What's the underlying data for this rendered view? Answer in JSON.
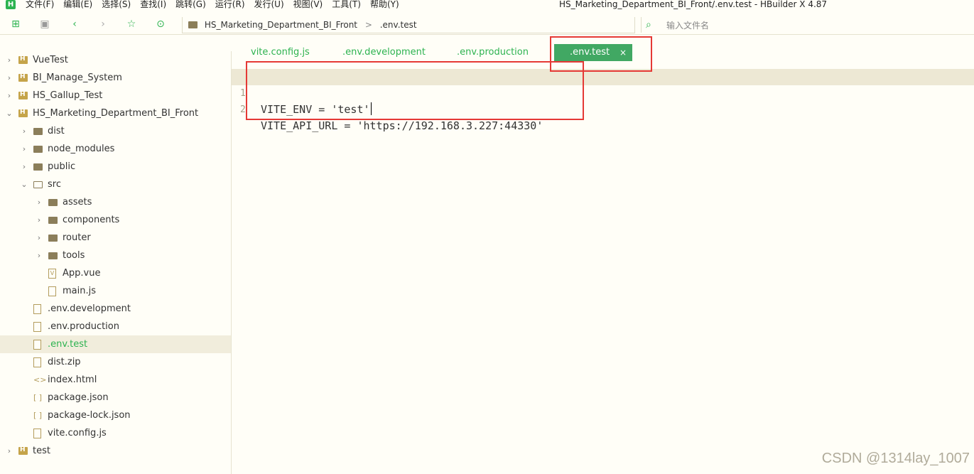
{
  "menubar": {
    "logo": "H",
    "items": [
      "文件(F)",
      "编辑(E)",
      "选择(S)",
      "查找(I)",
      "跳转(G)",
      "运行(R)",
      "发行(U)",
      "视图(V)",
      "工具(T)",
      "帮助(Y)"
    ],
    "window_title": "HS_Marketing_Department_BI_Front/.env.test - HBuilder X 4.87"
  },
  "toolbar": {
    "breadcrumb": [
      "HS_Marketing_Department_BI_Front",
      ".env.test"
    ],
    "breadcrumb_sep": ">",
    "search_placeholder": "输入文件名"
  },
  "sidebar": {
    "items": [
      {
        "label": "VueTest",
        "depth": 0,
        "icon": "project-icon",
        "expandable": true
      },
      {
        "label": "BI_Manage_System",
        "depth": 0,
        "icon": "project-icon",
        "expandable": true
      },
      {
        "label": "HS_Gallup_Test",
        "depth": 0,
        "icon": "project-icon",
        "expandable": true
      },
      {
        "label": "HS_Marketing_Department_BI_Front",
        "depth": 0,
        "icon": "project-icon",
        "expandable": true,
        "expanded": true
      },
      {
        "label": "dist",
        "depth": 1,
        "icon": "folder-icon",
        "expandable": true
      },
      {
        "label": "node_modules",
        "depth": 1,
        "icon": "folder-icon",
        "expandable": true
      },
      {
        "label": "public",
        "depth": 1,
        "icon": "folder-icon",
        "expandable": true
      },
      {
        "label": "src",
        "depth": 1,
        "icon": "folder-open-icon",
        "expandable": true,
        "expanded": true
      },
      {
        "label": "assets",
        "depth": 2,
        "icon": "folder-icon",
        "expandable": true
      },
      {
        "label": "components",
        "depth": 2,
        "icon": "folder-icon",
        "expandable": true
      },
      {
        "label": "router",
        "depth": 2,
        "icon": "folder-icon",
        "expandable": true
      },
      {
        "label": "tools",
        "depth": 2,
        "icon": "folder-icon",
        "expandable": true
      },
      {
        "label": "App.vue",
        "depth": 2,
        "icon": "vue-file-icon",
        "expandable": false
      },
      {
        "label": "main.js",
        "depth": 2,
        "icon": "js-file-icon",
        "expandable": false
      },
      {
        "label": ".env.development",
        "depth": 1,
        "icon": "file-icon",
        "expandable": false
      },
      {
        "label": ".env.production",
        "depth": 1,
        "icon": "file-icon",
        "expandable": false
      },
      {
        "label": ".env.test",
        "depth": 1,
        "icon": "file-icon",
        "expandable": false,
        "selected": true
      },
      {
        "label": "dist.zip",
        "depth": 1,
        "icon": "zip-file-icon",
        "expandable": false
      },
      {
        "label": "index.html",
        "depth": 1,
        "icon": "html-file-icon",
        "expandable": false
      },
      {
        "label": "package.json",
        "depth": 1,
        "icon": "json-file-icon",
        "expandable": false
      },
      {
        "label": "package-lock.json",
        "depth": 1,
        "icon": "json-file-icon",
        "expandable": false
      },
      {
        "label": "vite.config.js",
        "depth": 1,
        "icon": "js-file-icon",
        "expandable": false
      },
      {
        "label": "test",
        "depth": 0,
        "icon": "project-icon",
        "expandable": true
      }
    ]
  },
  "tabs": [
    {
      "label": "vite.config.js"
    },
    {
      "label": ".env.development"
    },
    {
      "label": ".env.production"
    },
    {
      "label": ".env.test",
      "active": true,
      "close": "×"
    }
  ],
  "editor": {
    "lines": [
      {
        "num": "1",
        "text": "VITE_ENV = 'test'"
      },
      {
        "num": "2",
        "text": "VITE_API_URL = 'https://192.168.3.227:44330'"
      }
    ]
  },
  "watermark": "CSDN @1314lay_1007",
  "colors": {
    "accent": "#2db350",
    "active_tab": "#41a863",
    "highlight": "#e53935",
    "background": "#fffef7"
  }
}
